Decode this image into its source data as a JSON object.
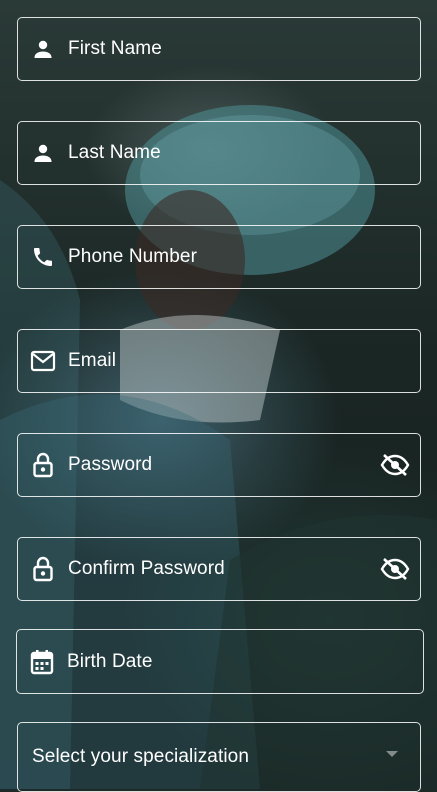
{
  "form": {
    "first_name": {
      "label": "First Name",
      "icon": "person-icon"
    },
    "last_name": {
      "label": "Last Name",
      "icon": "person-icon"
    },
    "phone": {
      "label": "Phone Number",
      "icon": "phone-icon"
    },
    "email": {
      "label": "Email",
      "icon": "mail-icon"
    },
    "password": {
      "label": "Password",
      "icon": "lock-icon",
      "toggle_icon": "eye-off-icon"
    },
    "confirm_password": {
      "label": "Confirm Password",
      "icon": "lock-icon",
      "toggle_icon": "eye-off-icon"
    },
    "birth_date": {
      "label": "Birth Date",
      "icon": "calendar-icon"
    },
    "specialization": {
      "placeholder": "Select your specialization",
      "icon": "dropdown-arrow-icon"
    }
  },
  "colors": {
    "text": "#ffffff",
    "border": "#ffffff",
    "background": "#1e2a28"
  }
}
